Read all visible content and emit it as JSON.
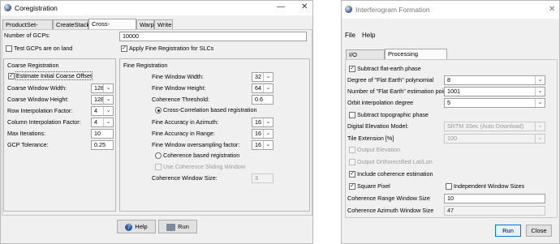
{
  "left": {
    "title": "Coregistration",
    "title_buttons": {
      "minimize": "—",
      "close": "✕"
    },
    "tabs": [
      "ProductSet-Reader",
      "CreateStack",
      "Cross-Correlation",
      "Warp",
      "Write"
    ],
    "num_gcps_label": "Number of GCPs:",
    "num_gcps_value": "10000",
    "test_gcps_label": "Test GCPs are on land",
    "apply_fine_label": "Apply Fine Registration for SLCs",
    "coarse": {
      "title": "Coarse Registration",
      "estimate_label": "Estimate Initial Coarse Offset",
      "window_width_label": "Coarse Window Width:",
      "window_width_value": "128",
      "window_height_label": "Coarse Window Height:",
      "window_height_value": "128",
      "row_interp_label": "Row Interpolation Factor:",
      "row_interp_value": "4",
      "col_interp_label": "Column Interpolation Factor:",
      "col_interp_value": "4",
      "max_iter_label": "Max Iterations:",
      "max_iter_value": "10",
      "gcp_tol_label": "GCP Tolerance:",
      "gcp_tol_value": "0.25"
    },
    "fine": {
      "title": "Fine Registration",
      "window_width_label": "Fine Window Width:",
      "window_width_value": "32",
      "window_height_label": "Fine Window Height:",
      "window_height_value": "64",
      "coh_thresh_label": "Coherence Threshold:",
      "coh_thresh_value": "0.6",
      "xcorr_label": "Cross-Correlation based registration",
      "acc_az_label": "Fine Accuracy in Azimuth:",
      "acc_az_value": "16",
      "acc_rg_label": "Fine Accuracy in Range:",
      "acc_rg_value": "16",
      "oversampling_label": "Fine Window oversampling factor:",
      "oversampling_value": "16",
      "coherence_reg_label": "Coherence based registration",
      "sliding_label": "Use Coherence Sliding Window",
      "coh_window_label": "Coherence Window Size:",
      "coh_window_value": "3"
    },
    "help_label": "Help",
    "run_label": "Run"
  },
  "right": {
    "title": "Interferogram Formation",
    "title_buttons": {
      "close": "✕"
    },
    "menu": [
      "File",
      "Help"
    ],
    "tabs": [
      "I/O Parameters",
      "Processing Parameters"
    ],
    "subtract_flat_label": "Subtract flat-earth phase",
    "degree_label": "Degree of \"Flat Earth\" polynomial",
    "degree_value": "8",
    "num_points_label": "Number of \"Flat Earth\" estimation points",
    "num_points_value": "1001",
    "orbit_label": "Orbit interpolation degree",
    "orbit_value": "5",
    "subtract_topo_label": "Subtract topographic phase",
    "dem_label": "Digital Elevation Model:",
    "dem_value": "SRTM 3Sec (Auto Download)",
    "tile_label": "Tile Extension [%]",
    "tile_value": "100",
    "out_elev_label": "Output Elevation",
    "out_ortho_label": "Output Orthorectified Lat/Lon",
    "include_coh_label": "Include coherence estimation",
    "square_pixel_label": "Square Pixel",
    "indep_window_label": "Independent Window Sizes",
    "coh_range_label": "Coherence Range Window Size",
    "coh_range_value": "10",
    "coh_az_label": "Coherence Azimuth Window Size",
    "coh_az_value": "47",
    "run_label": "Run",
    "close_label": "Close"
  },
  "colors": {
    "accent": "#0078d7",
    "window_bg": "#f0f0f0",
    "field_border": "#a0a0a0",
    "disabled_text": "#9a9a9a"
  }
}
